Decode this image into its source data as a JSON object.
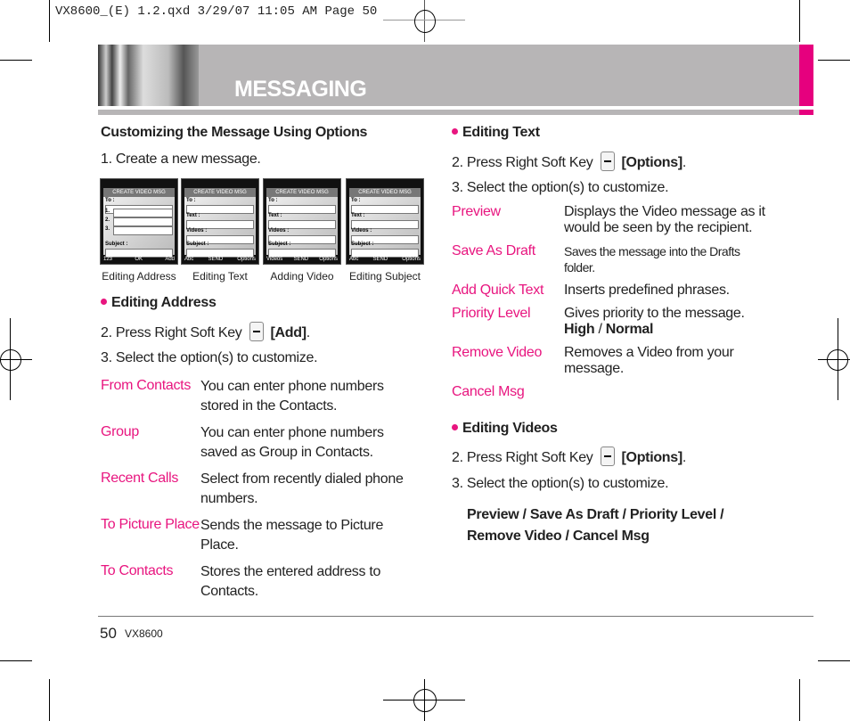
{
  "print_header": "VX8600_(E) 1.2.qxd  3/29/07  11:05 AM  Page 50",
  "banner": {
    "title": "MESSAGING",
    "accent": "#e6007e",
    "bar_color": "#b7b5b6"
  },
  "left": {
    "heading": "Customizing the Message Using Options",
    "step1": "1. Create a new message.",
    "screens": [
      {
        "caption": "Editing Address",
        "header": "CREATE VIDEO MSG",
        "soft": [
          "123",
          "OK",
          "Add"
        ]
      },
      {
        "caption": "Editing Text",
        "header": "CREATE VIDEO MSG",
        "soft": [
          "Abc",
          "SEND",
          "Options"
        ]
      },
      {
        "caption": "Adding Video",
        "header": "CREATE VIDEO MSG",
        "soft": [
          "Videos",
          "SEND",
          "Options"
        ]
      },
      {
        "caption": "Editing Subject",
        "header": "CREATE VIDEO MSG",
        "soft": [
          "Abc",
          "SEND",
          "Options"
        ]
      }
    ],
    "section": "Editing Address",
    "step2_prefix": "2. Press Right Soft Key",
    "step2_key": "[Add]",
    "step3": "3. Select the option(s) to customize.",
    "options": [
      {
        "term": "From Contacts",
        "desc": "You can enter phone numbers stored in the Contacts."
      },
      {
        "term": "Group",
        "desc": "You can enter phone numbers saved as Group in Contacts."
      },
      {
        "term": "Recent Calls",
        "desc": "Select from recently dialed phone numbers."
      },
      {
        "term": "To Picture Place",
        "desc": "Sends the message to Picture Place."
      },
      {
        "term": "To Contacts",
        "desc": "Stores the entered address to Contacts."
      }
    ]
  },
  "right": {
    "section1": "Editing Text",
    "step2_prefix": "2. Press Right Soft Key",
    "step2_key": "[Options]",
    "step3": "3. Select the option(s) to customize.",
    "options": [
      {
        "term": "Preview",
        "desc": "Displays the Video message as it would be seen by the recipient."
      },
      {
        "term": "Save As Draft",
        "desc": "Saves the message into the Drafts folder."
      },
      {
        "term": "Add Quick Text",
        "desc": "Inserts predefined phrases."
      },
      {
        "term": "Priority Level",
        "desc": "Gives priority to the message.",
        "extra": [
          "High",
          "Normal"
        ]
      },
      {
        "term": "Remove Video",
        "desc": "Removes a Video from your message."
      },
      {
        "term": "Cancel Msg",
        "desc": ""
      }
    ],
    "section2": "Editing Videos",
    "v_step2_prefix": "2. Press Right Soft Key",
    "v_step2_key": "[Options]",
    "v_step3": "3. Select the option(s) to customize.",
    "v_options": [
      "Preview",
      "Save As Draft",
      "Priority Level",
      "Remove Video",
      "Cancel Msg"
    ]
  },
  "footer": {
    "page": "50",
    "model": "VX8600"
  }
}
